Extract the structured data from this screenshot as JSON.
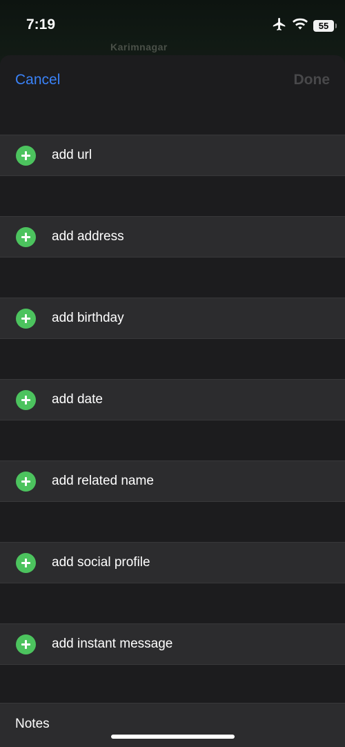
{
  "status_bar": {
    "time": "7:19",
    "battery_level": "55",
    "icons": [
      "airplane-icon",
      "wifi-icon",
      "battery-icon"
    ]
  },
  "background_map": {
    "label": "Karimnagar"
  },
  "nav": {
    "cancel_label": "Cancel",
    "done_label": "Done"
  },
  "rows": [
    {
      "label": "add url"
    },
    {
      "label": "add address"
    },
    {
      "label": "add birthday"
    },
    {
      "label": "add date"
    },
    {
      "label": "add related name"
    },
    {
      "label": "add social profile"
    },
    {
      "label": "add instant message"
    }
  ],
  "notes": {
    "label": "Notes"
  },
  "colors": {
    "accent_blue": "#3a82f7",
    "add_green": "#4cc35e",
    "row_bg": "#2c2c2e",
    "sheet_bg": "#1c1c1e",
    "disabled_text": "#48484a"
  }
}
